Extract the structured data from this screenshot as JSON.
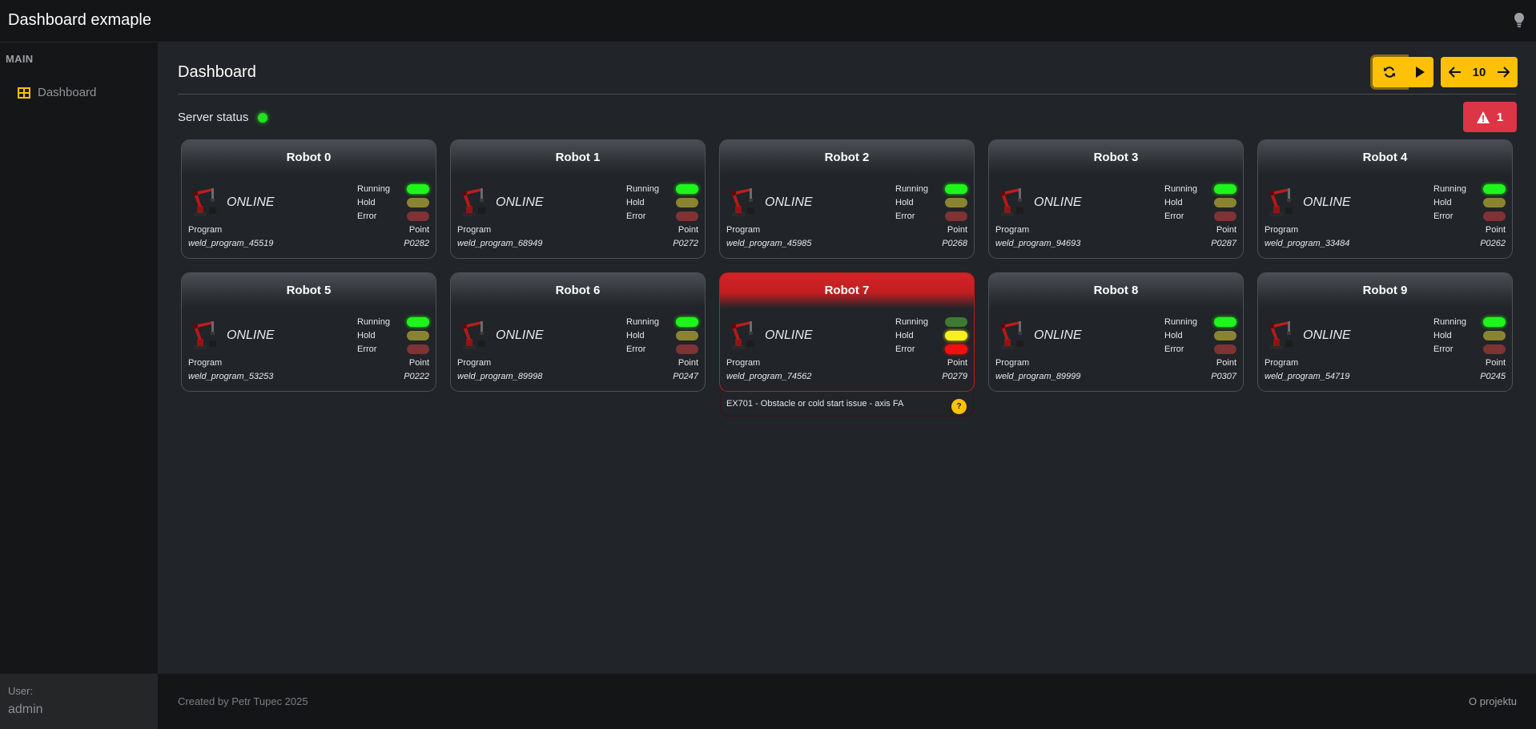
{
  "app": {
    "title": "Dashboard exmaple"
  },
  "sidebar": {
    "section": "MAIN",
    "items": [
      {
        "label": "Dashboard"
      }
    ]
  },
  "user": {
    "label": "User:",
    "name": "admin"
  },
  "footer": {
    "left": "Created by Petr Tupec 2025",
    "right": "O projektu"
  },
  "main": {
    "title": "Dashboard",
    "server_status_label": "Server status",
    "page_number": "10",
    "alert_count": "1"
  },
  "labels": {
    "running": "Running",
    "hold": "Hold",
    "error": "Error",
    "program": "Program",
    "point": "Point"
  },
  "colors": {
    "accent": "#ffc107",
    "danger": "#dc3545",
    "status_green": "#22e01f"
  },
  "robots": [
    {
      "name": "Robot 0",
      "status": "ONLINE",
      "program": "weld_program_45519",
      "point": "P0282",
      "running": true,
      "hold": false,
      "error": false
    },
    {
      "name": "Robot 1",
      "status": "ONLINE",
      "program": "weld_program_68949",
      "point": "P0272",
      "running": true,
      "hold": false,
      "error": false
    },
    {
      "name": "Robot 2",
      "status": "ONLINE",
      "program": "weld_program_45985",
      "point": "P0268",
      "running": true,
      "hold": false,
      "error": false
    },
    {
      "name": "Robot 3",
      "status": "ONLINE",
      "program": "weld_program_94693",
      "point": "P0287",
      "running": true,
      "hold": false,
      "error": false
    },
    {
      "name": "Robot 4",
      "status": "ONLINE",
      "program": "weld_program_33484",
      "point": "P0262",
      "running": true,
      "hold": false,
      "error": false
    },
    {
      "name": "Robot 5",
      "status": "ONLINE",
      "program": "weld_program_53253",
      "point": "P0222",
      "running": true,
      "hold": false,
      "error": false
    },
    {
      "name": "Robot 6",
      "status": "ONLINE",
      "program": "weld_program_89998",
      "point": "P0247",
      "running": true,
      "hold": false,
      "error": false
    },
    {
      "name": "Robot 7",
      "status": "ONLINE",
      "program": "weld_program_74562",
      "point": "P0279",
      "running": false,
      "hold": true,
      "error": true,
      "error_message": "EX701 - Obstacle or cold start issue - axis FA",
      "help": "?"
    },
    {
      "name": "Robot 8",
      "status": "ONLINE",
      "program": "weld_program_89999",
      "point": "P0307",
      "running": true,
      "hold": false,
      "error": false
    },
    {
      "name": "Robot 9",
      "status": "ONLINE",
      "program": "weld_program_54719",
      "point": "P0245",
      "running": true,
      "hold": false,
      "error": false
    }
  ]
}
